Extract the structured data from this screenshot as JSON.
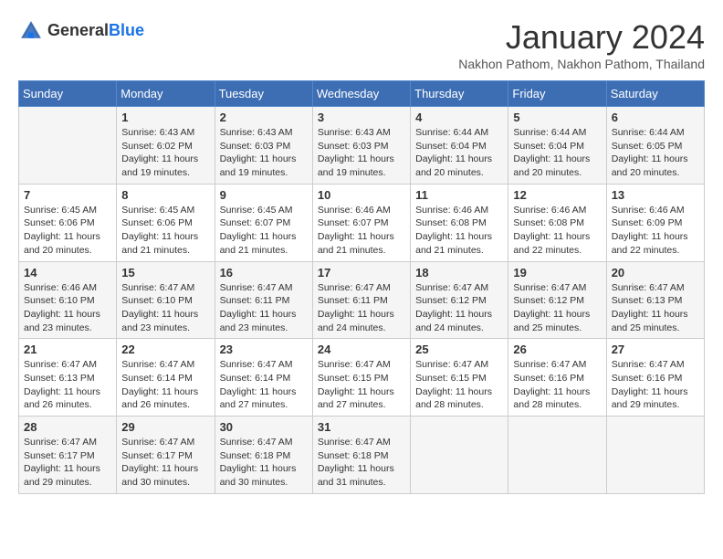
{
  "logo": {
    "general": "General",
    "blue": "Blue"
  },
  "title": "January 2024",
  "subtitle": "Nakhon Pathom, Nakhon Pathom, Thailand",
  "days_header": [
    "Sunday",
    "Monday",
    "Tuesday",
    "Wednesday",
    "Thursday",
    "Friday",
    "Saturday"
  ],
  "weeks": [
    [
      {
        "num": "",
        "info": ""
      },
      {
        "num": "1",
        "info": "Sunrise: 6:43 AM\nSunset: 6:02 PM\nDaylight: 11 hours\nand 19 minutes."
      },
      {
        "num": "2",
        "info": "Sunrise: 6:43 AM\nSunset: 6:03 PM\nDaylight: 11 hours\nand 19 minutes."
      },
      {
        "num": "3",
        "info": "Sunrise: 6:43 AM\nSunset: 6:03 PM\nDaylight: 11 hours\nand 19 minutes."
      },
      {
        "num": "4",
        "info": "Sunrise: 6:44 AM\nSunset: 6:04 PM\nDaylight: 11 hours\nand 20 minutes."
      },
      {
        "num": "5",
        "info": "Sunrise: 6:44 AM\nSunset: 6:04 PM\nDaylight: 11 hours\nand 20 minutes."
      },
      {
        "num": "6",
        "info": "Sunrise: 6:44 AM\nSunset: 6:05 PM\nDaylight: 11 hours\nand 20 minutes."
      }
    ],
    [
      {
        "num": "7",
        "info": "Sunrise: 6:45 AM\nSunset: 6:06 PM\nDaylight: 11 hours\nand 20 minutes."
      },
      {
        "num": "8",
        "info": "Sunrise: 6:45 AM\nSunset: 6:06 PM\nDaylight: 11 hours\nand 21 minutes."
      },
      {
        "num": "9",
        "info": "Sunrise: 6:45 AM\nSunset: 6:07 PM\nDaylight: 11 hours\nand 21 minutes."
      },
      {
        "num": "10",
        "info": "Sunrise: 6:46 AM\nSunset: 6:07 PM\nDaylight: 11 hours\nand 21 minutes."
      },
      {
        "num": "11",
        "info": "Sunrise: 6:46 AM\nSunset: 6:08 PM\nDaylight: 11 hours\nand 21 minutes."
      },
      {
        "num": "12",
        "info": "Sunrise: 6:46 AM\nSunset: 6:08 PM\nDaylight: 11 hours\nand 22 minutes."
      },
      {
        "num": "13",
        "info": "Sunrise: 6:46 AM\nSunset: 6:09 PM\nDaylight: 11 hours\nand 22 minutes."
      }
    ],
    [
      {
        "num": "14",
        "info": "Sunrise: 6:46 AM\nSunset: 6:10 PM\nDaylight: 11 hours\nand 23 minutes."
      },
      {
        "num": "15",
        "info": "Sunrise: 6:47 AM\nSunset: 6:10 PM\nDaylight: 11 hours\nand 23 minutes."
      },
      {
        "num": "16",
        "info": "Sunrise: 6:47 AM\nSunset: 6:11 PM\nDaylight: 11 hours\nand 23 minutes."
      },
      {
        "num": "17",
        "info": "Sunrise: 6:47 AM\nSunset: 6:11 PM\nDaylight: 11 hours\nand 24 minutes."
      },
      {
        "num": "18",
        "info": "Sunrise: 6:47 AM\nSunset: 6:12 PM\nDaylight: 11 hours\nand 24 minutes."
      },
      {
        "num": "19",
        "info": "Sunrise: 6:47 AM\nSunset: 6:12 PM\nDaylight: 11 hours\nand 25 minutes."
      },
      {
        "num": "20",
        "info": "Sunrise: 6:47 AM\nSunset: 6:13 PM\nDaylight: 11 hours\nand 25 minutes."
      }
    ],
    [
      {
        "num": "21",
        "info": "Sunrise: 6:47 AM\nSunset: 6:13 PM\nDaylight: 11 hours\nand 26 minutes."
      },
      {
        "num": "22",
        "info": "Sunrise: 6:47 AM\nSunset: 6:14 PM\nDaylight: 11 hours\nand 26 minutes."
      },
      {
        "num": "23",
        "info": "Sunrise: 6:47 AM\nSunset: 6:14 PM\nDaylight: 11 hours\nand 27 minutes."
      },
      {
        "num": "24",
        "info": "Sunrise: 6:47 AM\nSunset: 6:15 PM\nDaylight: 11 hours\nand 27 minutes."
      },
      {
        "num": "25",
        "info": "Sunrise: 6:47 AM\nSunset: 6:15 PM\nDaylight: 11 hours\nand 28 minutes."
      },
      {
        "num": "26",
        "info": "Sunrise: 6:47 AM\nSunset: 6:16 PM\nDaylight: 11 hours\nand 28 minutes."
      },
      {
        "num": "27",
        "info": "Sunrise: 6:47 AM\nSunset: 6:16 PM\nDaylight: 11 hours\nand 29 minutes."
      }
    ],
    [
      {
        "num": "28",
        "info": "Sunrise: 6:47 AM\nSunset: 6:17 PM\nDaylight: 11 hours\nand 29 minutes."
      },
      {
        "num": "29",
        "info": "Sunrise: 6:47 AM\nSunset: 6:17 PM\nDaylight: 11 hours\nand 30 minutes."
      },
      {
        "num": "30",
        "info": "Sunrise: 6:47 AM\nSunset: 6:18 PM\nDaylight: 11 hours\nand 30 minutes."
      },
      {
        "num": "31",
        "info": "Sunrise: 6:47 AM\nSunset: 6:18 PM\nDaylight: 11 hours\nand 31 minutes."
      },
      {
        "num": "",
        "info": ""
      },
      {
        "num": "",
        "info": ""
      },
      {
        "num": "",
        "info": ""
      }
    ]
  ]
}
